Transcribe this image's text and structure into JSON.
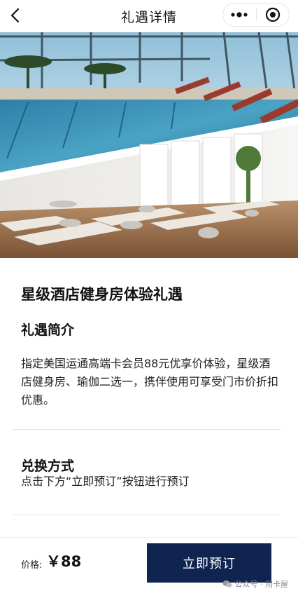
{
  "navbar": {
    "title": "礼遇详情",
    "back_icon": "chevron-left-icon",
    "more_icon": "more-dots-icon",
    "close_icon": "target-circle-icon"
  },
  "hero": {
    "image_description_icon": "hotel-pool-and-yoga-room-photo"
  },
  "offer": {
    "title": "星级酒店健身房体验礼遇"
  },
  "intro": {
    "heading": "礼遇简介",
    "body": "指定美国运通高端卡会员88元优享价体验，星级酒店健身房、瑜伽二选一，携伴使用可享受门市价折扣优惠。"
  },
  "redeem": {
    "heading": "兑换方式",
    "body": "点击下方“立即预订”按钮进行预订"
  },
  "footer": {
    "price_label": "价格:",
    "price_value": "￥88",
    "book_button": "立即预订"
  },
  "watermark": {
    "text": "公众号 · 用卡屋",
    "icon": "wechat-icon"
  },
  "colors": {
    "button_bg": "#0f2451",
    "divider": "#e3e3e3"
  }
}
